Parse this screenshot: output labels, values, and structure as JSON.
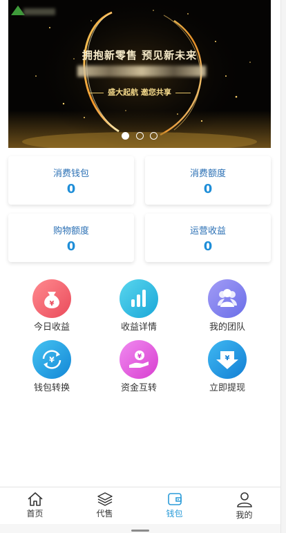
{
  "banner": {
    "headline": "拥抱新零售 预见新未来",
    "tagline": "盛大起航 邀您共享",
    "slides": 3,
    "active_slide": 1
  },
  "stats": [
    {
      "label": "消费钱包",
      "value": "0"
    },
    {
      "label": "消费额度",
      "value": "0"
    },
    {
      "label": "购物额度",
      "value": "0"
    },
    {
      "label": "运营收益",
      "value": "0"
    }
  ],
  "grid": [
    {
      "label": "今日收益",
      "icon": "money-bag-icon",
      "color": "#f25f6b"
    },
    {
      "label": "收益详情",
      "icon": "bar-chart-icon",
      "color": "#2fbde3"
    },
    {
      "label": "我的团队",
      "icon": "team-icon",
      "color": "#7b7df0"
    },
    {
      "label": "钱包转换",
      "icon": "exchange-icon",
      "color": "#1aa0e8"
    },
    {
      "label": "资金互转",
      "icon": "hand-coin-icon",
      "color": "#e44fd6"
    },
    {
      "label": "立即提现",
      "icon": "withdraw-icon",
      "color": "#1a9be6"
    }
  ],
  "tabs": [
    {
      "label": "首页",
      "icon": "home-icon",
      "active": false
    },
    {
      "label": "代售",
      "icon": "layers-icon",
      "active": false
    },
    {
      "label": "钱包",
      "icon": "wallet-icon",
      "active": true
    },
    {
      "label": "我的",
      "icon": "user-icon",
      "active": false
    }
  ],
  "colors": {
    "accent": "#1f8ed8",
    "active_tab": "#2a9bd8"
  }
}
